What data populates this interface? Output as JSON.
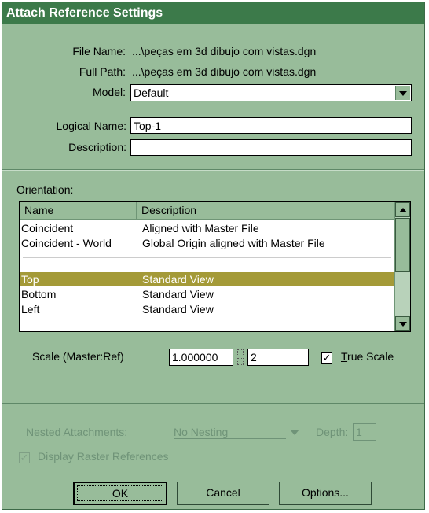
{
  "dialog": {
    "title": "Attach Reference Settings",
    "file_name_label": "File Name:",
    "file_name_value": "...\\peças em 3d dibujo com vistas.dgn",
    "full_path_label": "Full Path:",
    "full_path_value": "...\\peças em 3d dibujo com vistas.dgn",
    "model_label": "Model:",
    "model_value": "Default",
    "logical_name_label": "Logical Name:",
    "logical_name_value": "Top-1",
    "description_label": "Description:",
    "description_value": ""
  },
  "orientation": {
    "label": "Orientation:",
    "columns": [
      "Name",
      "Description"
    ],
    "rows": [
      {
        "name": "Coincident",
        "description": "Aligned with Master File"
      },
      {
        "name": "Coincident - World",
        "description": "Global Origin aligned with Master File"
      },
      {
        "name": "Top",
        "description": "Standard View",
        "selected": true
      },
      {
        "name": "Bottom",
        "description": "Standard View"
      },
      {
        "name": "Left",
        "description": "Standard View"
      }
    ]
  },
  "scale": {
    "label": "Scale (Master:Ref)",
    "master_value": "1.000000",
    "ref_value": "2",
    "true_scale_label": "True Scale",
    "true_scale_checked": true
  },
  "nesting": {
    "label": "Nested Attachments:",
    "value": "No Nesting",
    "depth_label": "Depth:",
    "depth_value": "1",
    "display_raster_label": "Display Raster References",
    "display_raster_checked": true
  },
  "buttons": {
    "ok": "OK",
    "cancel": "Cancel",
    "options": "Options..."
  },
  "colors": {
    "dialog_bg": "#98bc9a",
    "titlebar": "#3c7a4a",
    "selection": "#a49a38"
  }
}
